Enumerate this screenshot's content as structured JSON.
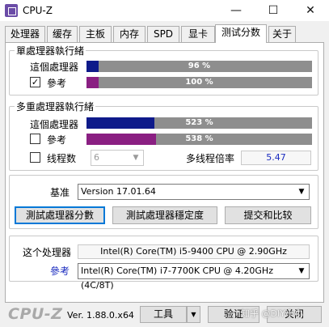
{
  "window": {
    "title": "CPU-Z",
    "minimize": "—",
    "maximize": "☐",
    "close": "✕"
  },
  "tabs": [
    {
      "label": "处理器",
      "active": false
    },
    {
      "label": "缓存",
      "active": false
    },
    {
      "label": "主板",
      "active": false
    },
    {
      "label": "内存",
      "active": false
    },
    {
      "label": "SPD",
      "active": false
    },
    {
      "label": "显卡",
      "active": false
    },
    {
      "label": "测试分数",
      "active": true
    },
    {
      "label": "关于",
      "active": false
    }
  ],
  "single": {
    "title": "單處理器執行緒",
    "this_label": "這個處理器",
    "this_value": "96 %",
    "this_fraction": 0.052,
    "ref_label": "參考",
    "ref_checked": "✓",
    "ref_value": "100 %",
    "ref_fraction": 0.054
  },
  "multi": {
    "title": "多重處理器執行緒",
    "this_label": "這個處理器",
    "this_value": "523 %",
    "this_fraction": 0.302,
    "ref_label": "參考",
    "ref_value": "538 %",
    "ref_fraction": 0.31,
    "threads_label": "线程数",
    "threads_value": "6",
    "ratio_label": "多线程倍率",
    "ratio_value": "5.47"
  },
  "benchmark": {
    "label": "基准",
    "version": "Version 17.01.64",
    "btn_bench": "測試處理器分數",
    "btn_stability": "測試處理器穩定度",
    "btn_submit": "提交和比较"
  },
  "processor": {
    "this_label": "这个处理器",
    "this_value": "Intel(R) Core(TM) i5-9400 CPU @ 2.90GHz",
    "ref_label": "參考",
    "ref_value": "Intel(R) Core(TM) i7-7700K CPU @ 4.20GHz (4C/8T)"
  },
  "footer": {
    "logo": "CPU-Z",
    "version": "Ver. 1.88.0.x64",
    "tools": "工具",
    "validate": "验证",
    "close": "关闭",
    "watermark": "知乎 @DIY小小"
  },
  "colors": {
    "this_bar": "#0e1a8a",
    "ref_bar": "#8a1f82",
    "bar_bg": "#8e8e8e"
  }
}
